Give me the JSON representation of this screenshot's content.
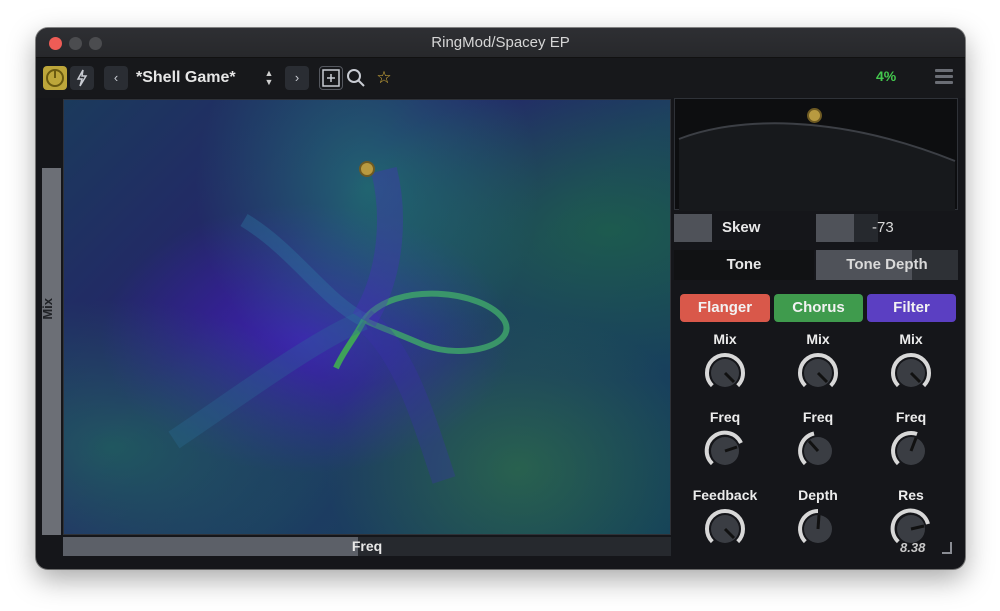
{
  "window": {
    "title": "RingMod/Spacey EP"
  },
  "toolbar": {
    "power_icon": "power-icon",
    "bolt_icon": "lightning-icon",
    "prev_label": "‹",
    "next_label": "›",
    "preset_name": "*Shell Game*",
    "save_icon": "save-plus-icon",
    "search_icon": "search-icon",
    "star_icon": "star-icon",
    "cpu": "4%",
    "menu_icon": "hamburger-menu-icon"
  },
  "xy_pad": {
    "x_label": "Freq",
    "y_label": "Mix",
    "x_value": 0.5,
    "y_value": 0.84
  },
  "curve": {
    "handle_position": 0.5
  },
  "skew": {
    "label": "Skew",
    "value": "-73"
  },
  "tone_tabs": {
    "tone_label": "Tone",
    "depth_label": "Tone Depth"
  },
  "effects": [
    {
      "name": "Flanger",
      "color": "#d9584a",
      "knobs": [
        "Mix",
        "Freq",
        "Feedback"
      ]
    },
    {
      "name": "Chorus",
      "color": "#3f9b4d",
      "knobs": [
        "Mix",
        "Freq",
        "Depth"
      ]
    },
    {
      "name": "Filter",
      "color": "#5b3fc2",
      "knobs": [
        "Mix",
        "Freq",
        "Res"
      ]
    }
  ],
  "footer": {
    "version": "8.38"
  },
  "colors": {
    "accent_gold": "#b89a40",
    "cpu_green": "#44c84e"
  }
}
